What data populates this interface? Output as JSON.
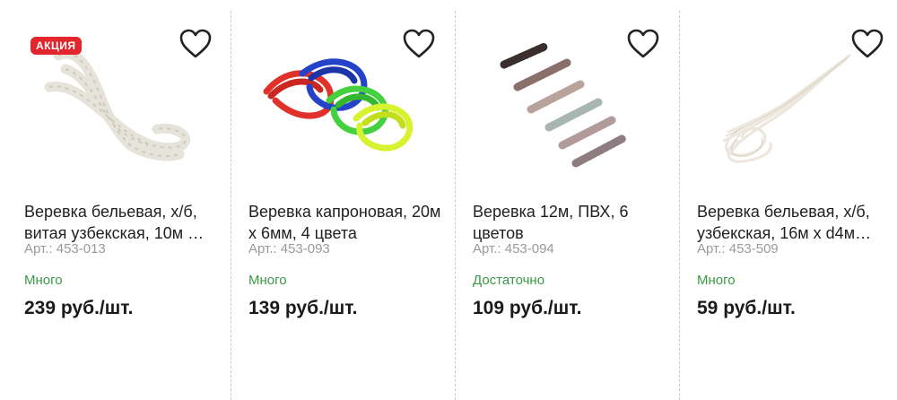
{
  "products": [
    {
      "badge": "АКЦИЯ",
      "title": "Веревка бельевая, х/б, витая узбекская, 10м …",
      "article": "Арт.: 453-013",
      "stock": "Много",
      "price": "239 руб./шт."
    },
    {
      "title": "Веревка капроновая, 20м х 6мм, 4 цвета",
      "article": "Арт.: 453-093",
      "stock": "Много",
      "price": "139 руб./шт."
    },
    {
      "title": "Веревка 12м, ПВХ, 6 цветов",
      "article": "Арт.: 453-094",
      "stock": "Достаточно",
      "price": "109 руб./шт."
    },
    {
      "title": "Веревка бельевая, х/б, узбекская, 16м х d4м…",
      "article": "Арт.: 453-509",
      "stock": "Много",
      "price": "59 руб./шт."
    }
  ],
  "colors": {
    "badge": "#e3262d",
    "stock": "#3a9a46",
    "article": "#9a9a9a"
  },
  "icons": {
    "favorite": "heart-outline-icon"
  }
}
